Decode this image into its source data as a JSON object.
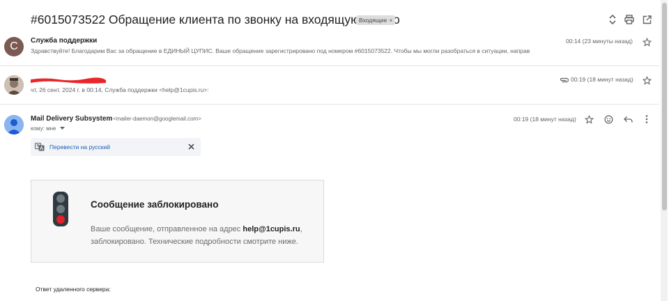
{
  "thread": {
    "subject": "#6015073522 Обращение клиента по звонку на входящую линию",
    "label": "Входящие",
    "label_close": "×",
    "icons": {
      "expand": "unfold-icon",
      "print": "printer-icon",
      "new_window": "open-in-new-icon"
    }
  },
  "messages": [
    {
      "avatar_letter": "С",
      "sender": "Служба поддержки",
      "snippet": "Здравствуйте! Благодарим Вас за обращение в ЕДИНЫЙ ЦУПИС. Ваше обращение зарегистрировано под номером #6015073522. Чтобы мы могли разобраться в ситуации, направ",
      "time": "00:14 (23 минуты назад)"
    },
    {
      "sender_redacted": true,
      "snippet": "чт, 26 сент. 2024 г. в 00:14, Служба поддержки <help@1cupis.ru>:",
      "time": "00:19 (18 минут назад)",
      "has_attachment": true
    },
    {
      "sender": "Mail Delivery Subsystem",
      "sender_email": "<mailer-daemon@googlemail.com>",
      "to_line": "кому: мне",
      "time": "00:19 (18 минут назад)"
    }
  ],
  "translate": {
    "link": "Перевести на русский"
  },
  "blocked": {
    "title": "Сообщение заблокировано",
    "body_prefix": "Ваше сообщение, отправленное на адрес ",
    "address": "help@1cupis.ru",
    "body_suffix": ",",
    "body_line2": "заблокировано. Технические подробности смотрите ниже."
  },
  "remote_response": "Ответ удаленного сервера:",
  "colors": {
    "accent_link": "#1a5fb4",
    "avatar_brown": "#7a5a52",
    "redaction": "#e8262c",
    "traffic_light_red": "#e4202a"
  }
}
